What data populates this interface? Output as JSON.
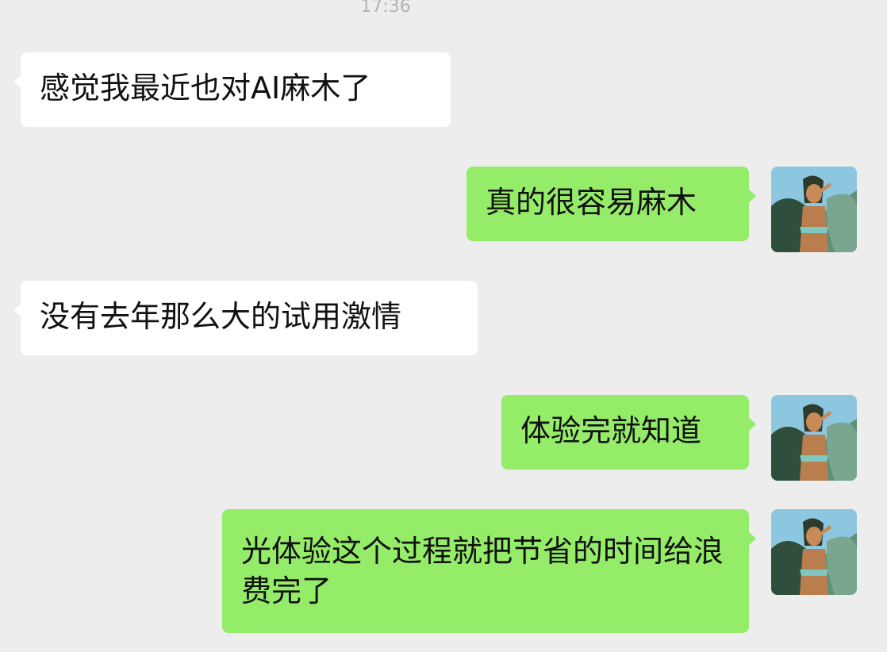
{
  "timestamp": "17:36",
  "messages": [
    {
      "side": "incoming",
      "text": "感觉我最近也对AI麻木了"
    },
    {
      "side": "outgoing",
      "text": "真的很容易麻木",
      "avatar": "user-avatar"
    },
    {
      "side": "incoming",
      "text": "没有去年那么大的试用激情"
    },
    {
      "side": "outgoing",
      "text": "体验完就知道",
      "avatar": "user-avatar"
    },
    {
      "side": "outgoing",
      "text": "光体验这个过程就把节省的时间给浪费完了",
      "avatar": "user-avatar"
    }
  ],
  "colors": {
    "chat_background": "#ededed",
    "incoming_bubble": "#ffffff",
    "outgoing_bubble": "#95ec69",
    "message_text": "#111111",
    "timestamp_text": "#b2b2b2"
  }
}
